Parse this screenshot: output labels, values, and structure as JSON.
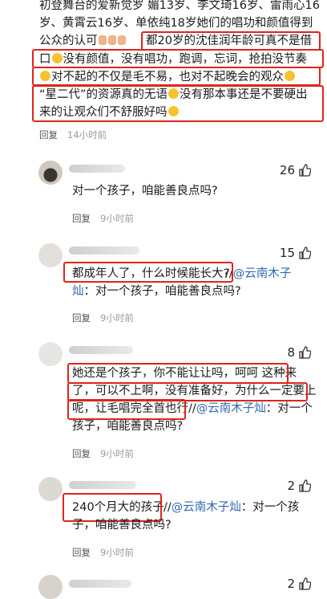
{
  "comment0": {
    "lines": [
      "初登舞台的爱新觉罗 媚13岁、李文琦16岁、雷雨心16",
      "岁、黄霄云16岁、单依纯18岁她们的唱功和颜值得到",
      "公众的认可",
      "都20岁的沈佳润年龄可真不是借",
      "口",
      "没有颜值，没有唱功，跑调，忘词，抢拍没节奏",
      "对不起的不仅是毛不易，也对不起晚会的观众",
      "“星二代”的资源真的无语",
      "没有那本事还是不要硬出",
      "来的让观众们不舒服好吗"
    ],
    "reply": "回复",
    "time": "14小时前"
  },
  "comments": [
    {
      "likes": "26",
      "text": "对一个孩子，咱能善良点吗?",
      "reply": "回复",
      "time": "9小时前"
    },
    {
      "likes": "15",
      "text_a": "都成年人了，什么时候能长大?",
      "text_b": "//",
      "mention": "@云南木子",
      "line2_mention": "灿",
      "line2": "：对一个孩子，咱能善良点吗?",
      "reply": "回复",
      "time": "9小时前"
    },
    {
      "likes": "8",
      "line1": "她还是个孩子，你不能让让吗，呵呵 这种来",
      "line2": "了，可以不上啊，没有准备好，为什么一定要上",
      "line3_a": "呢，让毛唱完全首也行",
      "line3_b": "//",
      "line3_mention": "@云南木子灿",
      "line3_c": "：对一个",
      "line4": "孩子，咱能善良点吗?",
      "reply": "回复",
      "time": "9小时前"
    },
    {
      "likes": "2",
      "line1_a": "240个月大的孩子",
      "line1_b": "//",
      "line1_mention": "@云南木子灿",
      "line1_c": "：对一个孩",
      "line2": "子，咱能善良点吗?",
      "reply": "回复",
      "time": "9小时前"
    },
    {
      "likes": "2"
    }
  ],
  "colors": {
    "highlight": "#e0241b",
    "mention": "#2f67b2"
  }
}
